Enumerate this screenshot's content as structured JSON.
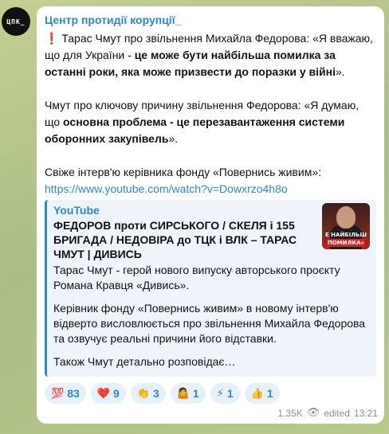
{
  "channel": {
    "avatar_text": "ЦПК_",
    "name": "Центр протидії корупції_"
  },
  "post": {
    "p1_mark": "❗",
    "p1_a": " Тарас Чмут про звільнення Михайла Федорова: «Я вважаю, що для України - ",
    "p1_b": "це може бути найбільша помилка за останні роки, яка може призвести до поразки у війні",
    "p1_c": "».",
    "p2_a": "Чмут про ключову причину звільнення Федорова: «Я думаю, що ",
    "p2_b": "основна проблема - це перезавантаження системи оборонних закупівель",
    "p2_c": "».",
    "p3": "Свіже інтерв'ю керівника фонду «Повернись живим»:",
    "link": "https://www.youtube.com/watch?v=Dowxrzo4h8o"
  },
  "preview": {
    "site": "YouTube",
    "title": "ФЕДОРОВ проти СИРСЬКОГО / СКЕЛЯ і 155 БРИГАДА / НЕДОВІРА до ТЦК і ВЛК – ТАРАС ЧМУТ | ДИВИСЬ",
    "desc1": "Тарас Чмут - герой нового випуску авторського проєкту Романа Кравця «Дивись».",
    "desc2": "Керівник фонду «Повернись живим» в новому інтерв'ю відверто висловлюється про звільнення Михайла Федорова та озвучує реальні причини його відставки.",
    "desc3": "Також Чмут детально розповідає…",
    "thumb_caption1": "Е НАЙБІЛЬШ",
    "thumb_caption2": "ПОМИЛКА»"
  },
  "reactions": [
    {
      "emoji": "💯",
      "count": "83"
    },
    {
      "emoji": "❤️",
      "count": "9"
    },
    {
      "emoji": "👏",
      "count": "3"
    },
    {
      "emoji": "🤷",
      "count": "1"
    },
    {
      "emoji": "⚡",
      "count": "1"
    },
    {
      "emoji": "👍",
      "count": "1"
    }
  ],
  "meta": {
    "views": "1.35K",
    "edited": "edited",
    "time": "13:21"
  }
}
